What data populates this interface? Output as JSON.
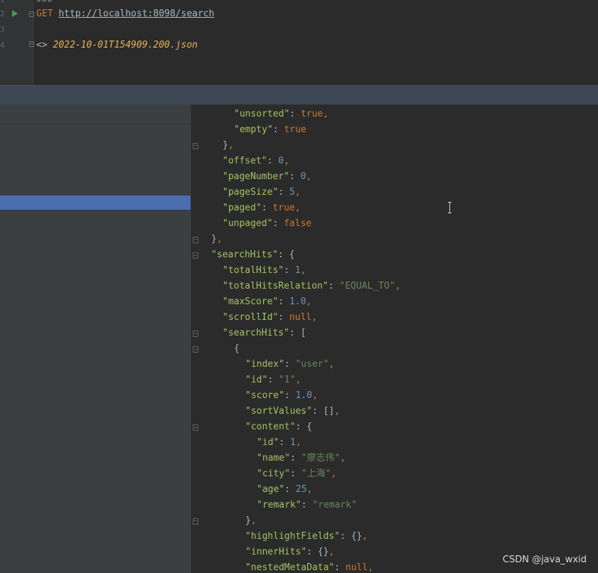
{
  "editor": {
    "line_numbers": [
      "1",
      "2",
      "3",
      "4"
    ],
    "line1_comment": "###",
    "line2_method": "GET",
    "line2_url": "http://localhost:8098/search",
    "line4_prefix": "<>",
    "line4_file": "2022-10-01T154909.200.json"
  },
  "response": {
    "lines": [
      {
        "indent": 2,
        "key": "\"unsorted\"",
        "value": "true",
        "vtype": "b",
        "comma": true
      },
      {
        "indent": 2,
        "key": "\"empty\"",
        "value": "true",
        "vtype": "b",
        "comma": false
      },
      {
        "indent": 1,
        "text": "},",
        "fold": "up"
      },
      {
        "indent": 1,
        "key": "\"offset\"",
        "value": "0",
        "vtype": "n",
        "comma": true
      },
      {
        "indent": 1,
        "key": "\"pageNumber\"",
        "value": "0",
        "vtype": "n",
        "comma": true
      },
      {
        "indent": 1,
        "key": "\"pageSize\"",
        "value": "5",
        "vtype": "n",
        "comma": true
      },
      {
        "indent": 1,
        "key": "\"paged\"",
        "value": "true",
        "vtype": "b",
        "comma": true
      },
      {
        "indent": 1,
        "key": "\"unpaged\"",
        "value": "false",
        "vtype": "b",
        "comma": false
      },
      {
        "indent": 0,
        "text": "},",
        "fold": "up"
      },
      {
        "indent": 0,
        "key": "\"searchHits\"",
        "value": "{",
        "vtype": "o",
        "comma": false,
        "fold": "down"
      },
      {
        "indent": 1,
        "key": "\"totalHits\"",
        "value": "1",
        "vtype": "n",
        "comma": true
      },
      {
        "indent": 1,
        "key": "\"totalHitsRelation\"",
        "value": "\"EQUAL_TO\"",
        "vtype": "s",
        "comma": true
      },
      {
        "indent": 1,
        "key": "\"maxScore\"",
        "value": "1.0",
        "vtype": "n",
        "comma": true
      },
      {
        "indent": 1,
        "key": "\"scrollId\"",
        "value": "null",
        "vtype": "b",
        "comma": true
      },
      {
        "indent": 1,
        "key": "\"searchHits\"",
        "value": "[",
        "vtype": "o",
        "comma": false,
        "fold": "down"
      },
      {
        "indent": 2,
        "text": "{",
        "fold": "down"
      },
      {
        "indent": 3,
        "key": "\"index\"",
        "value": "\"user\"",
        "vtype": "s",
        "comma": true
      },
      {
        "indent": 3,
        "key": "\"id\"",
        "value": "\"1\"",
        "vtype": "s",
        "comma": true
      },
      {
        "indent": 3,
        "key": "\"score\"",
        "value": "1.0",
        "vtype": "n",
        "comma": true
      },
      {
        "indent": 3,
        "key": "\"sortValues\"",
        "value": "[]",
        "vtype": "o",
        "comma": true
      },
      {
        "indent": 3,
        "key": "\"content\"",
        "value": "{",
        "vtype": "o",
        "comma": false,
        "fold": "down"
      },
      {
        "indent": 4,
        "key": "\"id\"",
        "value": "1",
        "vtype": "n",
        "comma": true
      },
      {
        "indent": 4,
        "key": "\"name\"",
        "value": "\"廖志伟\"",
        "vtype": "s",
        "comma": true
      },
      {
        "indent": 4,
        "key": "\"city\"",
        "value": "\"上海\"",
        "vtype": "s",
        "comma": true
      },
      {
        "indent": 4,
        "key": "\"age\"",
        "value": "25",
        "vtype": "n",
        "comma": true
      },
      {
        "indent": 4,
        "key": "\"remark\"",
        "value": "\"remark\"",
        "vtype": "s",
        "comma": false
      },
      {
        "indent": 3,
        "text": "},",
        "fold": "up"
      },
      {
        "indent": 3,
        "key": "\"highlightFields\"",
        "value": "{}",
        "vtype": "o",
        "comma": true
      },
      {
        "indent": 3,
        "key": "\"innerHits\"",
        "value": "{}",
        "vtype": "o",
        "comma": true
      },
      {
        "indent": 3,
        "key": "\"nestedMetaData\"",
        "value": "null",
        "vtype": "b",
        "comma": true
      }
    ]
  },
  "watermark": "CSDN @java_wxid",
  "colors": {
    "key": "#9876aa",
    "string": "#6a8759",
    "number": "#6897bb",
    "keyword": "#cc7832",
    "selection": "#4b6eaf"
  }
}
